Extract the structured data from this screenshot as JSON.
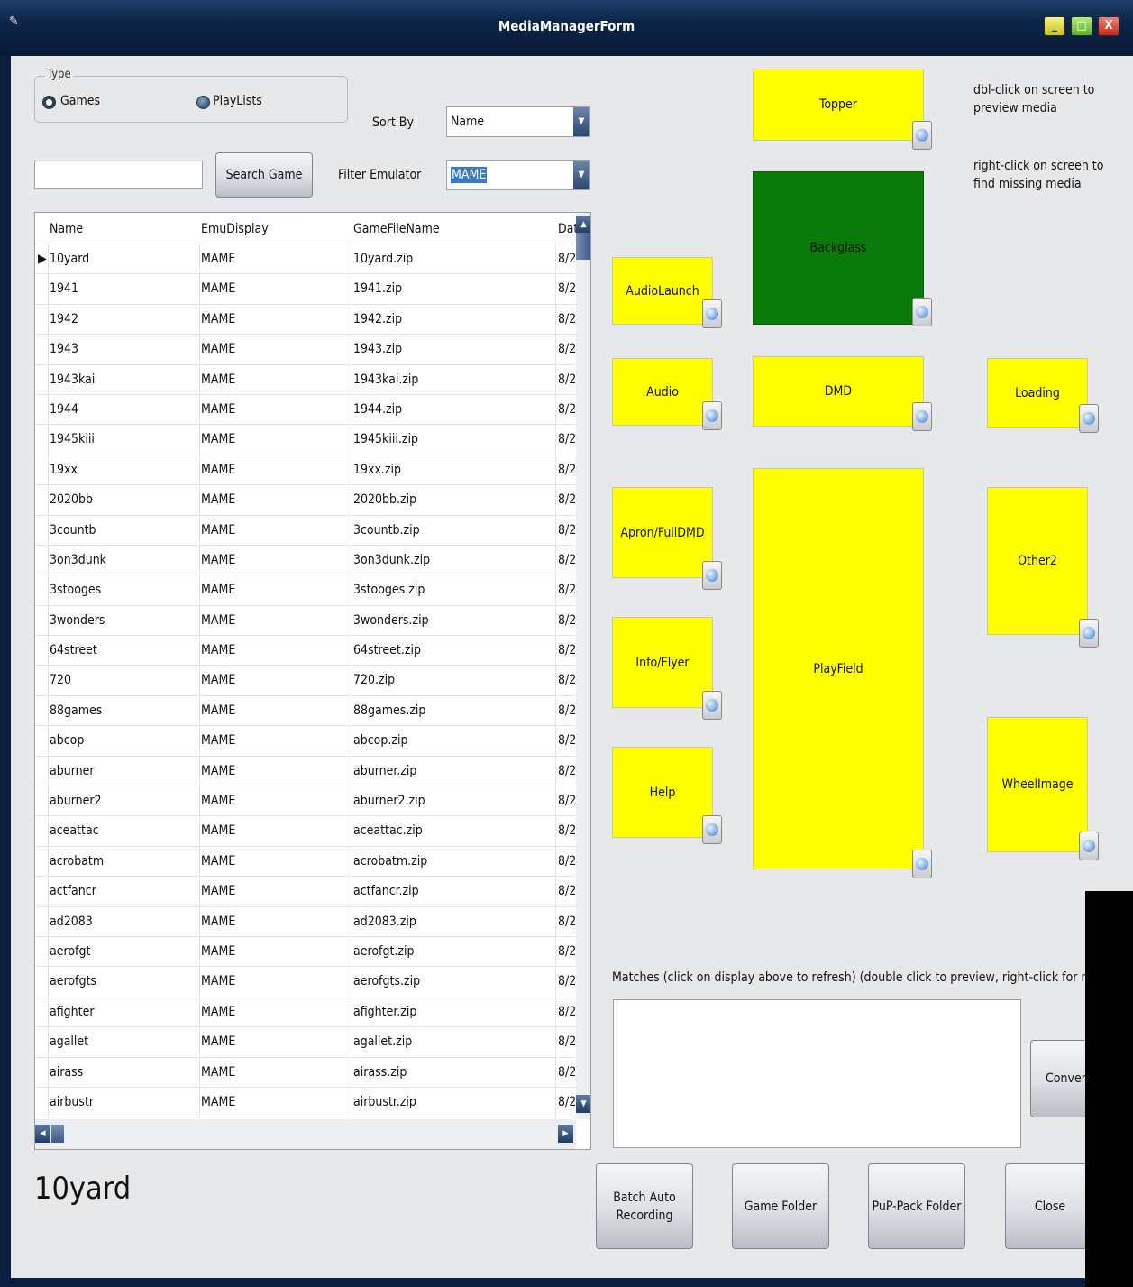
{
  "window": {
    "title": "MediaManagerForm",
    "min_label": "_",
    "max_label": "□",
    "close_label": "X"
  },
  "type_group": {
    "legend": "Type",
    "games": "Games",
    "playlists": "PlayLists",
    "selected": "Games"
  },
  "sort": {
    "label": "Sort By",
    "value": "Name"
  },
  "filter": {
    "label": "Filter Emulator",
    "value": "MAME"
  },
  "search": {
    "value": "",
    "button": "Search Game"
  },
  "grid": {
    "columns": [
      "Name",
      "EmuDisplay",
      "GameFileName",
      "Dat"
    ],
    "rows": [
      [
        "10yard",
        "MAME",
        "10yard.zip",
        "8/2"
      ],
      [
        "1941",
        "MAME",
        "1941.zip",
        "8/2"
      ],
      [
        "1942",
        "MAME",
        "1942.zip",
        "8/2"
      ],
      [
        "1943",
        "MAME",
        "1943.zip",
        "8/2"
      ],
      [
        "1943kai",
        "MAME",
        "1943kai.zip",
        "8/2"
      ],
      [
        "1944",
        "MAME",
        "1944.zip",
        "8/2"
      ],
      [
        "1945kiii",
        "MAME",
        "1945kiii.zip",
        "8/2"
      ],
      [
        "19xx",
        "MAME",
        "19xx.zip",
        "8/2"
      ],
      [
        "2020bb",
        "MAME",
        "2020bb.zip",
        "8/2"
      ],
      [
        "3countb",
        "MAME",
        "3countb.zip",
        "8/2"
      ],
      [
        "3on3dunk",
        "MAME",
        "3on3dunk.zip",
        "8/2"
      ],
      [
        "3stooges",
        "MAME",
        "3stooges.zip",
        "8/2"
      ],
      [
        "3wonders",
        "MAME",
        "3wonders.zip",
        "8/2"
      ],
      [
        "64street",
        "MAME",
        "64street.zip",
        "8/2"
      ],
      [
        "720",
        "MAME",
        "720.zip",
        "8/2"
      ],
      [
        "88games",
        "MAME",
        "88games.zip",
        "8/2"
      ],
      [
        "abcop",
        "MAME",
        "abcop.zip",
        "8/2"
      ],
      [
        "aburner",
        "MAME",
        "aburner.zip",
        "8/2"
      ],
      [
        "aburner2",
        "MAME",
        "aburner2.zip",
        "8/2"
      ],
      [
        "aceattac",
        "MAME",
        "aceattac.zip",
        "8/2"
      ],
      [
        "acrobatm",
        "MAME",
        "acrobatm.zip",
        "8/2"
      ],
      [
        "actfancr",
        "MAME",
        "actfancr.zip",
        "8/2"
      ],
      [
        "ad2083",
        "MAME",
        "ad2083.zip",
        "8/2"
      ],
      [
        "aerofgt",
        "MAME",
        "aerofgt.zip",
        "8/2"
      ],
      [
        "aerofgts",
        "MAME",
        "aerofgts.zip",
        "8/2"
      ],
      [
        "afighter",
        "MAME",
        "afighter.zip",
        "8/2"
      ],
      [
        "agallet",
        "MAME",
        "agallet.zip",
        "8/2"
      ],
      [
        "airass",
        "MAME",
        "airass.zip",
        "8/2"
      ],
      [
        "airbustr",
        "MAME",
        "airbustr.zip",
        "8/2"
      ]
    ],
    "selected_row": 0
  },
  "selected_game": "10yard",
  "screens": {
    "topper": "Topper",
    "backglass": "Backglass",
    "audiolaunch": "AudioLaunch",
    "audio": "Audio",
    "dmd": "DMD",
    "loading": "Loading",
    "apron": "Apron/FullDMD",
    "playfield": "PlayField",
    "other2": "Other2",
    "info": "Info/Flyer",
    "help": "Help",
    "wheel": "WheelImage"
  },
  "colors": {
    "screen_default": "#ffff00",
    "screen_active": "#0a7a0a"
  },
  "hints": {
    "dblclick": "dbl-click on screen to preview media",
    "rightclick": "right-click on screen to find missing media"
  },
  "matches_label": "Matches (click on display above to refresh)  (double click to preview, right-click for more)",
  "buttons": {
    "convert": "Convert",
    "batch": "Batch Auto Recording",
    "game_folder": "Game Folder",
    "pup_folder": "PuP-Pack Folder",
    "close": "Close"
  }
}
